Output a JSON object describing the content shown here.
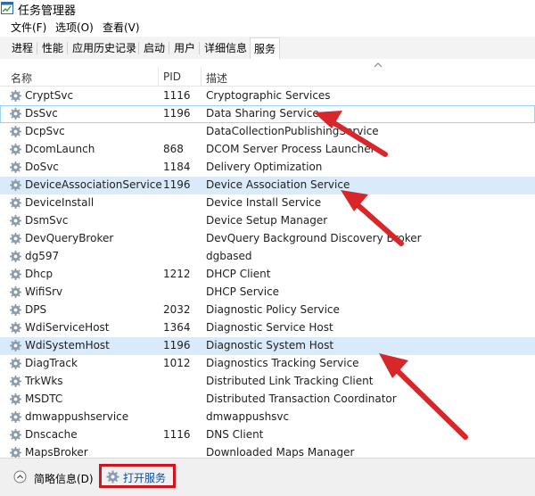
{
  "window": {
    "title": "任务管理器"
  },
  "menu": {
    "file": "文件(F)",
    "options": "选项(O)",
    "view": "查看(V)"
  },
  "tabs": [
    {
      "label": "进程"
    },
    {
      "label": "性能"
    },
    {
      "label": "应用历史记录"
    },
    {
      "label": "启动"
    },
    {
      "label": "用户"
    },
    {
      "label": "详细信息"
    },
    {
      "label": "服务"
    }
  ],
  "active_tab": "服务",
  "columns": {
    "name": "名称",
    "pid": "PID",
    "desc": "描述"
  },
  "services": [
    {
      "name": "CryptSvc",
      "pid": "1116",
      "desc": "Cryptographic Services"
    },
    {
      "name": "DsSvc",
      "pid": "1196",
      "desc": "Data Sharing Service"
    },
    {
      "name": "DcpSvc",
      "pid": "",
      "desc": "DataCollectionPublishingService"
    },
    {
      "name": "DcomLaunch",
      "pid": "868",
      "desc": "DCOM Server Process Launcher"
    },
    {
      "name": "DoSvc",
      "pid": "1184",
      "desc": "Delivery Optimization"
    },
    {
      "name": "DeviceAssociationService",
      "pid": "1196",
      "desc": "Device Association Service"
    },
    {
      "name": "DeviceInstall",
      "pid": "",
      "desc": "Device Install Service"
    },
    {
      "name": "DsmSvc",
      "pid": "",
      "desc": "Device Setup Manager"
    },
    {
      "name": "DevQueryBroker",
      "pid": "",
      "desc": "DevQuery Background Discovery Broker"
    },
    {
      "name": "dg597",
      "pid": "",
      "desc": "dgbased"
    },
    {
      "name": "Dhcp",
      "pid": "1212",
      "desc": "DHCP Client"
    },
    {
      "name": "WifiSrv",
      "pid": "",
      "desc": "DHCP Service"
    },
    {
      "name": "DPS",
      "pid": "2032",
      "desc": "Diagnostic Policy Service"
    },
    {
      "name": "WdiServiceHost",
      "pid": "1364",
      "desc": "Diagnostic Service Host"
    },
    {
      "name": "WdiSystemHost",
      "pid": "1196",
      "desc": "Diagnostic System Host"
    },
    {
      "name": "DiagTrack",
      "pid": "1012",
      "desc": "Diagnostics Tracking Service"
    },
    {
      "name": "TrkWks",
      "pid": "",
      "desc": "Distributed Link Tracking Client"
    },
    {
      "name": "MSDTC",
      "pid": "",
      "desc": "Distributed Transaction Coordinator"
    },
    {
      "name": "dmwappushservice",
      "pid": "",
      "desc": "dmwappushsvc"
    },
    {
      "name": "Dnscache",
      "pid": "1116",
      "desc": "DNS Client"
    },
    {
      "name": "MapsBroker",
      "pid": "",
      "desc": "Downloaded Maps Manager"
    }
  ],
  "footer": {
    "fewer_details": "简略信息(D)",
    "open_services": "打开服务"
  },
  "colors": {
    "selection": "#cce8ff",
    "highlight_row": "#d9ebfa",
    "annotation_red": "#d0151d"
  }
}
